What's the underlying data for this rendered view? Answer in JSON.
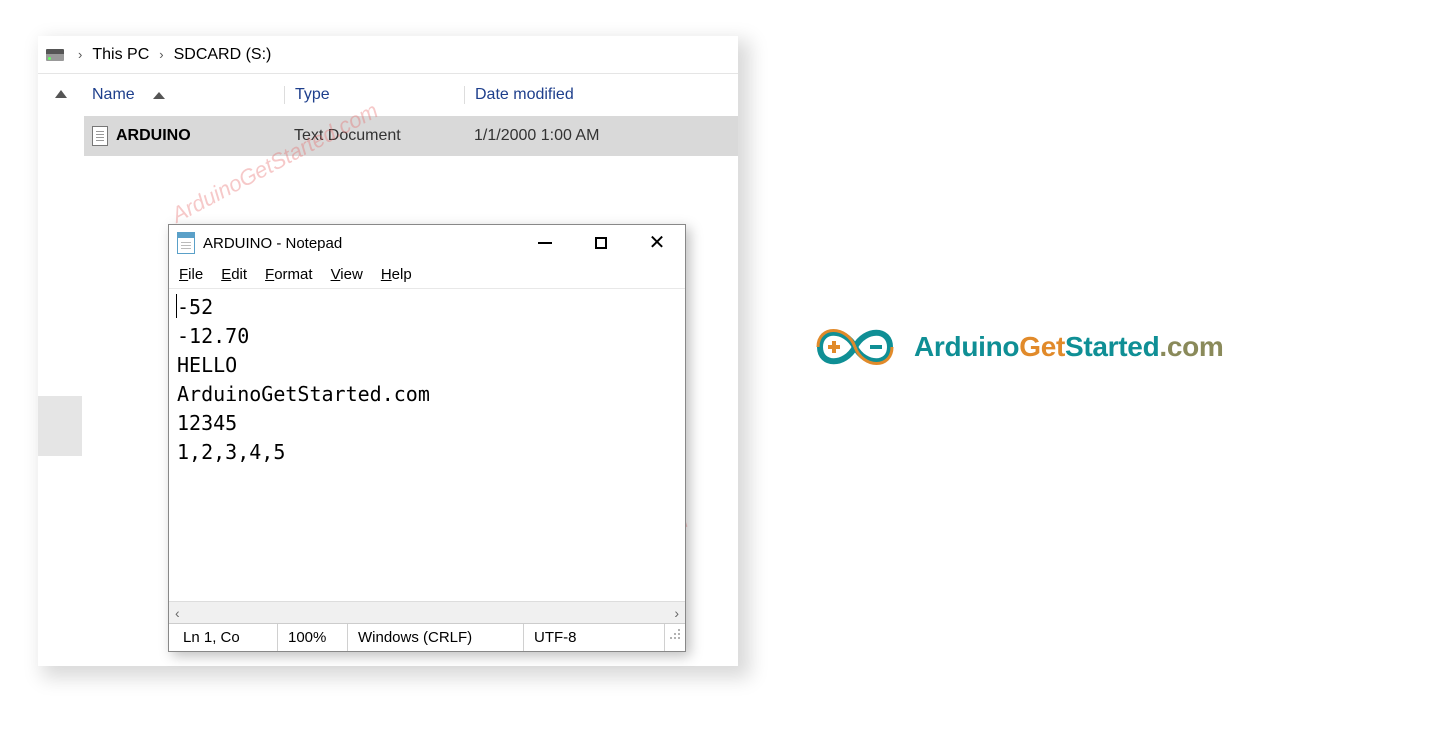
{
  "explorer": {
    "breadcrumb": {
      "root": "This PC",
      "leaf": "SDCARD (S:)"
    },
    "columns": {
      "name": "Name",
      "type": "Type",
      "date": "Date modified"
    },
    "file": {
      "name": "ARDUINO",
      "type": "Text Document",
      "date": "1/1/2000 1:00 AM"
    }
  },
  "notepad": {
    "title": "ARDUINO - Notepad",
    "menu": [
      "File",
      "Edit",
      "Format",
      "View",
      "Help"
    ],
    "lines": [
      "-52",
      "-12.70",
      "HELLO",
      "ArduinoGetStarted.com",
      "12345",
      "1,2,3,4,5"
    ],
    "status": {
      "pos": "Ln 1, Co",
      "zoom": "100%",
      "eol": "Windows (CRLF)",
      "enc": "UTF-8"
    }
  },
  "watermark": "ArduinoGetStarted.com",
  "brand": {
    "a": "Arduino",
    "g": "Get",
    "s": "Started",
    "c": ".com"
  }
}
